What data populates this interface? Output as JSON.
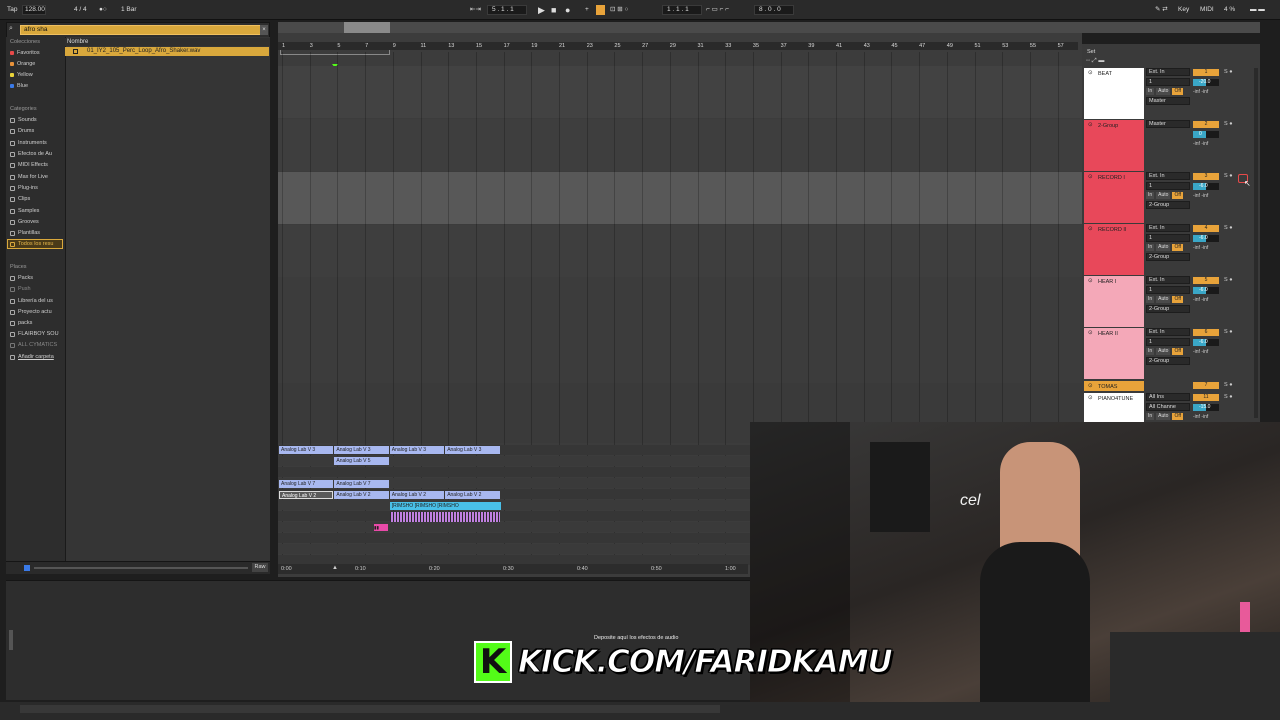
{
  "transport": {
    "tap": "Tap",
    "tempo": "128.00",
    "signature": "4 / 4",
    "metronome": "●○",
    "quantize": "1 Bar",
    "position": "5 .  1 .  1",
    "loop_start": "1 .  1 .  1",
    "loop_length": "8 .  0 .  0",
    "key": "Key",
    "midi": "MIDI",
    "cpu": "4 %"
  },
  "browser": {
    "search_value": "afro sha",
    "collections_header": "Colecciones",
    "collections": [
      {
        "label": "Favoritos",
        "color": "#e84a4a"
      },
      {
        "label": "Orange",
        "color": "#e8923a"
      },
      {
        "label": "Yellow",
        "color": "#e8d23a"
      },
      {
        "label": "Blue",
        "color": "#3a7ae8"
      }
    ],
    "categories_header": "Categories",
    "categories": [
      "Sounds",
      "Drums",
      "Instruments",
      "Efectos de Au",
      "MIDI Effects",
      "Max for Live",
      "Plug-ins",
      "Clips",
      "Samples",
      "Grooves",
      "Plantillas",
      "Todos los resu"
    ],
    "places_header": "Places",
    "places": [
      "Packs",
      "Push",
      "Librería del us",
      "Proyecto actu",
      "packs",
      "FLAIRBOY SOU",
      "ALL CYMATICS",
      "Añadir carpeta"
    ],
    "column_header": "Nombre",
    "result_file": "01_IY2_105_Perc_Loop_Afro_Shaker.wav",
    "raw_label": "Raw"
  },
  "ruler": [
    "1",
    "3",
    "5",
    "7",
    "9",
    "11",
    "13",
    "15",
    "17",
    "19",
    "21",
    "23",
    "25",
    "27",
    "29",
    "31",
    "33",
    "35",
    "37",
    "39",
    "41",
    "43",
    "45",
    "47",
    "49",
    "51",
    "53",
    "55",
    "57"
  ],
  "time_labels": [
    "0:00",
    "0:10",
    "0:20",
    "0:30",
    "0:40",
    "0:50",
    "1:00"
  ],
  "clips": [
    {
      "label": "Analog Lab V 3",
      "row": 0,
      "col": 0,
      "color": "#a8b8f0"
    },
    {
      "label": "Analog Lab V 3",
      "row": 0,
      "col": 1,
      "color": "#a8b8f0"
    },
    {
      "label": "Analog Lab V 3",
      "row": 0,
      "col": 2,
      "color": "#a8b8f0"
    },
    {
      "label": "Analog Lab V 3",
      "row": 0,
      "col": 3,
      "color": "#a8b8f0"
    },
    {
      "label": "Analog Lab V 5",
      "row": 1,
      "col": 1,
      "color": "#a8b8f0"
    },
    {
      "label": "Analog Lab V 7",
      "row": 3,
      "col": 0,
      "color": "#a8b8f0"
    },
    {
      "label": "Analog Lab V 7",
      "row": 3,
      "col": 1,
      "color": "#a8b8f0"
    },
    {
      "label": "Analog Lab V 2",
      "row": 4,
      "col": 0,
      "color": "#5a5a5a"
    },
    {
      "label": "Analog Lab V 2",
      "row": 4,
      "col": 1,
      "color": "#a8b8f0"
    },
    {
      "label": "Analog Lab V 2",
      "row": 4,
      "col": 2,
      "color": "#a8b8f0"
    },
    {
      "label": "Analog Lab V 2",
      "row": 4,
      "col": 3,
      "color": "#a8b8f0"
    },
    {
      "label": "[RIMSHO [RIMSHO [RIMSHO",
      "row": 5,
      "col": 2,
      "color": "#49c0e8"
    }
  ],
  "set_label": "Set",
  "tracks": [
    {
      "name": "BEAT",
      "color": "#ffffff",
      "input": "Ext. In",
      "channel": "1",
      "output": "Master",
      "number": "1",
      "volume": "-20.0"
    },
    {
      "name": "2-Group",
      "color": "#e8485a",
      "input": "Master",
      "channel": "",
      "output": "",
      "number": "2",
      "volume": "0"
    },
    {
      "name": "RECORD I",
      "color": "#e8485a",
      "input": "Ext. In",
      "channel": "1",
      "output": "2-Group",
      "number": "3",
      "volume": "-6.0"
    },
    {
      "name": "RECORD II",
      "color": "#e8485a",
      "input": "Ext. In",
      "channel": "1",
      "output": "2-Group",
      "number": "4",
      "volume": "-6.0"
    },
    {
      "name": "HEAR I",
      "color": "#f4a8b8",
      "input": "Ext. In",
      "channel": "1",
      "output": "2-Group",
      "number": "5",
      "volume": "-6.0"
    },
    {
      "name": "HEAR II",
      "color": "#f4a8b8",
      "input": "Ext. In",
      "channel": "1",
      "output": "2-Group",
      "number": "6",
      "volume": "-6.0"
    },
    {
      "name": "TOMAS",
      "color": "#e8a33a",
      "input": "",
      "channel": "",
      "output": "",
      "number": "7",
      "volume": ""
    },
    {
      "name": "PIANO4TUNE",
      "color": "#ffffff",
      "input": "All Ins",
      "channel": "All Channe",
      "output": "",
      "number": "11",
      "volume": "-15.0"
    }
  ],
  "detail_hint": "Deposite aquí los efectos de audio",
  "kick_text": "KICK.COM/FARIDKAMU",
  "kick_logo": "K"
}
